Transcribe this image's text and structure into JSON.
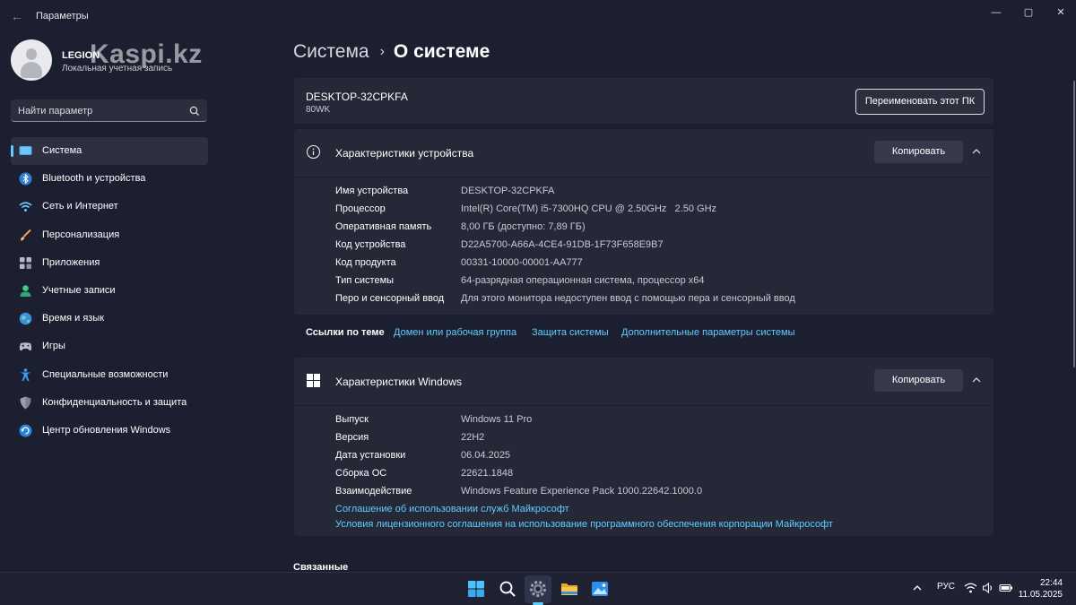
{
  "window": {
    "title": "Параметры",
    "back_icon": "←",
    "minimize_icon": "—",
    "maximize_icon": "▢",
    "close_icon": "✕"
  },
  "profile": {
    "name": "LEGION",
    "account_type": "Локальная учетная запись"
  },
  "watermark": "Kaspi.kz",
  "search": {
    "placeholder": "Найти параметр"
  },
  "sidebar": {
    "items": [
      {
        "label": "Система",
        "icon": "system-icon",
        "active": true
      },
      {
        "label": "Bluetooth и устройства",
        "icon": "bluetooth-icon"
      },
      {
        "label": "Сеть и Интернет",
        "icon": "wifi-icon"
      },
      {
        "label": "Персонализация",
        "icon": "brush-icon"
      },
      {
        "label": "Приложения",
        "icon": "apps-icon"
      },
      {
        "label": "Учетные записи",
        "icon": "accounts-icon"
      },
      {
        "label": "Время и язык",
        "icon": "globe-icon"
      },
      {
        "label": "Игры",
        "icon": "gamepad-icon"
      },
      {
        "label": "Специальные возможности",
        "icon": "accessibility-icon"
      },
      {
        "label": "Конфиденциальность и защита",
        "icon": "shield-icon"
      },
      {
        "label": "Центр обновления Windows",
        "icon": "update-icon"
      }
    ]
  },
  "breadcrumb": {
    "parent": "Система",
    "separator": "›",
    "current": "О системе"
  },
  "pc": {
    "name": "DESKTOP-32CPKFA",
    "model": "80WK",
    "rename_label": "Переименовать этот ПК"
  },
  "device_specs": {
    "title": "Характеристики устройства",
    "copy_label": "Копировать",
    "rows": [
      {
        "key": "Имя устройства",
        "value": "DESKTOP-32CPKFA"
      },
      {
        "key": "Процессор",
        "value": "Intel(R) Core(TM) i5-7300HQ CPU @ 2.50GHz   2.50 GHz"
      },
      {
        "key": "Оперативная память",
        "value": "8,00 ГБ (доступно: 7,89 ГБ)"
      },
      {
        "key": "Код устройства",
        "value": "D22A5700-A66A-4CE4-91DB-1F73F658E9B7"
      },
      {
        "key": "Код продукта",
        "value": "00331-10000-00001-AA777"
      },
      {
        "key": "Тип системы",
        "value": "64-разрядная операционная система, процессор x64"
      },
      {
        "key": "Перо и сенсорный ввод",
        "value": "Для этого монитора недоступен ввод с помощью пера и сенсорный ввод"
      }
    ]
  },
  "related_links": {
    "label": "Ссылки по теме",
    "links": [
      "Домен или рабочая группа",
      "Защита системы",
      "Дополнительные параметры системы"
    ]
  },
  "windows_specs": {
    "title": "Характеристики Windows",
    "copy_label": "Копировать",
    "rows": [
      {
        "key": "Выпуск",
        "value": "Windows 11 Pro"
      },
      {
        "key": "Версия",
        "value": "22H2"
      },
      {
        "key": "Дата установки",
        "value": "06.04.2025"
      },
      {
        "key": "Сборка ОС",
        "value": "22621.1848"
      },
      {
        "key": "Взаимодействие",
        "value": "Windows Feature Experience Pack 1000.22642.1000.0"
      }
    ],
    "links": [
      "Соглашение об использовании служб Майкрософт",
      "Условия лицензионного соглашения на использование программного обеспечения корпорации Майкрософт"
    ]
  },
  "related_section_title": "Связанные",
  "taskbar": {
    "apps": [
      "start-icon",
      "search-icon",
      "settings-icon",
      "file-explorer-icon",
      "photos-icon"
    ],
    "active_app": "settings-icon",
    "tray_language": "РУС",
    "time": "22:44",
    "date": "11.05.2025"
  },
  "colors": {
    "accent": "#60cdff",
    "window_bg": "#1c1f2f",
    "card_bg": "#252837"
  }
}
